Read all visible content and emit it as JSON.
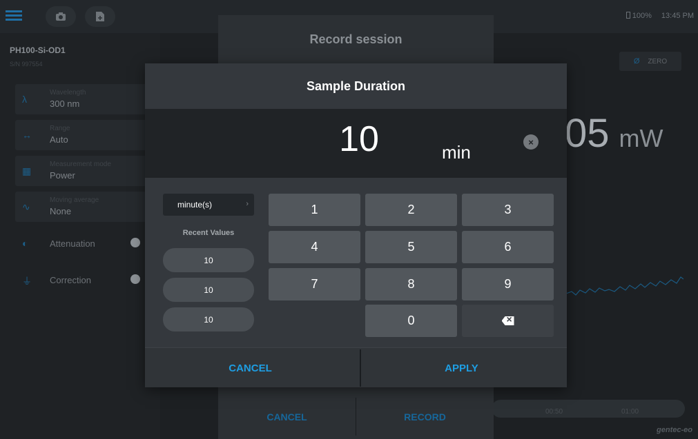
{
  "status": {
    "battery": "100%",
    "time": "13:45 PM"
  },
  "device": {
    "name": "PH100-Si-OD1",
    "serial": "S/N 997554"
  },
  "params": [
    {
      "label": "Wavelength",
      "value": "300 nm",
      "icon": "lambda-icon"
    },
    {
      "label": "Range",
      "value": "Auto",
      "icon": "range-icon"
    },
    {
      "label": "Measurement mode",
      "value": "Power",
      "icon": "grid-icon"
    },
    {
      "label": "Moving average",
      "value": "None",
      "icon": "wave-icon"
    }
  ],
  "toggles": [
    {
      "label": "Attenuation",
      "icon": "attenuation-icon"
    },
    {
      "label": "Correction",
      "icon": "correction-icon"
    }
  ],
  "zero": {
    "label": "ZERO",
    "symbol": "Ø"
  },
  "reading": {
    "value": "05",
    "unit": "mW"
  },
  "timeline_ticks": [
    "00:50",
    "01:00"
  ],
  "brand": "gentec-eo",
  "record_dialog": {
    "title": "Record session",
    "cancel": "CANCEL",
    "record": "RECORD"
  },
  "sample_duration": {
    "title": "Sample Duration",
    "value": "10",
    "unit": "min",
    "unit_select": "minute(s)",
    "recent_label": "Recent Values",
    "recent_values": [
      "10",
      "10",
      "10"
    ],
    "keys": [
      "1",
      "2",
      "3",
      "4",
      "5",
      "6",
      "7",
      "8",
      "9",
      "0"
    ],
    "cancel": "CANCEL",
    "apply": "APPLY"
  },
  "colors": {
    "accent": "#1e9ee3",
    "dialog": "#34383d",
    "key": "#52575c"
  }
}
